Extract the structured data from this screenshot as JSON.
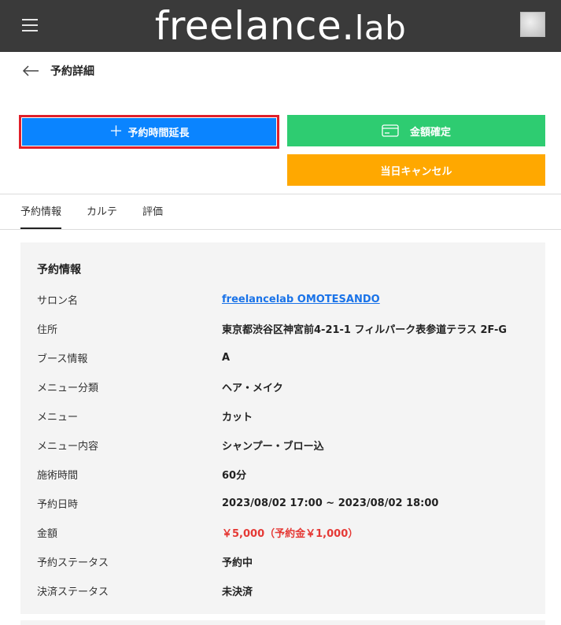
{
  "header": {
    "logo": {
      "main": "freelance",
      "dot": ".",
      "sub": "lab"
    },
    "menu_icon": "hamburger-icon",
    "avatar_icon": "user-avatar"
  },
  "page": {
    "title": "予約詳細",
    "back_icon": "arrow-left-icon"
  },
  "actions": {
    "extend": {
      "label": "予約時間延長",
      "icon": "plus-icon",
      "color": "#0a84ff",
      "highlight": "#e0202a"
    },
    "confirm": {
      "label": "金額確定",
      "icon": "card-icon",
      "color": "#2ecc71"
    },
    "cancel": {
      "label": "当日キャンセル",
      "color": "#ffa800"
    }
  },
  "tabs": [
    {
      "label": "予約情報",
      "active": true
    },
    {
      "label": "カルテ",
      "active": false
    },
    {
      "label": "評価",
      "active": false
    }
  ],
  "reservation": {
    "title": "予約情報",
    "rows": [
      {
        "label": "サロン名",
        "value": "freelancelab OMOTESANDO"
      },
      {
        "label": "住所",
        "value": "東京都渋谷区神宮前4-21-1 フィルパーク表参道テラス 2F-G"
      },
      {
        "label": "ブース情報",
        "value": "A"
      },
      {
        "label": "メニュー分類",
        "value": "ヘア・メイク"
      },
      {
        "label": "メニュー",
        "value": "カット"
      },
      {
        "label": "メニュー内容",
        "value": "シャンプー・ブロー込"
      },
      {
        "label": "施術時間",
        "value": "60分"
      },
      {
        "label": "予約日時",
        "value": "2023/08/02 17:00 ~ 2023/08/02 18:00"
      },
      {
        "label": "金額",
        "value": "￥5,000（予約金￥1,000）"
      },
      {
        "label": "予約ステータス",
        "value": "予約中"
      },
      {
        "label": "決済ステータス",
        "value": "未決済"
      }
    ]
  },
  "colors": {
    "header_bg": "#3a3a3a",
    "link": "#1a73e8",
    "price": "#e53935",
    "panel_bg": "#f4f4f4"
  }
}
